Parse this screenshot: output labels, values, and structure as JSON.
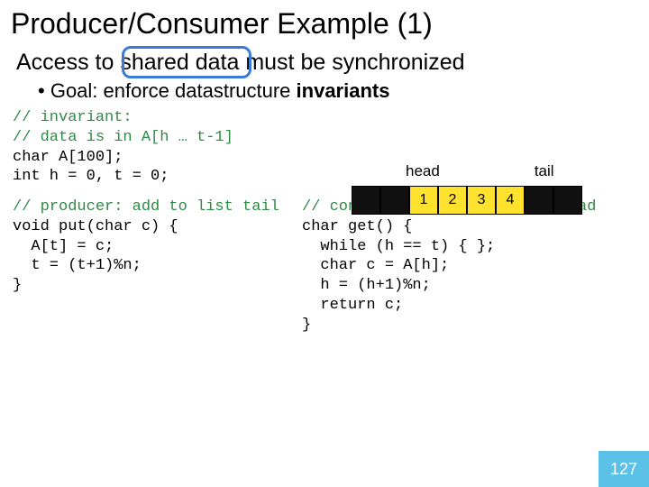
{
  "title": "Producer/Consumer Example (1)",
  "access": {
    "pre": "Access to ",
    "highlight": "shared data",
    "post": " must be synchronized"
  },
  "bullet": {
    "dot": "•  ",
    "pre": "Goal: enforce datastructure ",
    "bold": "invariants"
  },
  "invariant": {
    "l1": "// invariant:",
    "l2": "// data is in A[h … t-1]",
    "l3": "char A[100];",
    "l4": "int h = 0, t = 0;"
  },
  "diagram": {
    "head_label": "head",
    "tail_label": "tail",
    "cells": [
      "",
      "",
      "1",
      "2",
      "3",
      "4",
      "",
      ""
    ]
  },
  "producer": {
    "c1": "// producer: add to list tail",
    "l1": "void put(char c) {",
    "l2": "  A[t] = c;",
    "l3": "  t = (t+1)%n;",
    "l4": "}"
  },
  "consumer": {
    "c1": "// consumer: take from list head",
    "l1": "char get() {",
    "l2": "  while (h == t) { };",
    "l3": "  char c = A[h];",
    "l4": "  h = (h+1)%n;",
    "l5": "  return c;",
    "l6": "}"
  },
  "page_number": "127"
}
